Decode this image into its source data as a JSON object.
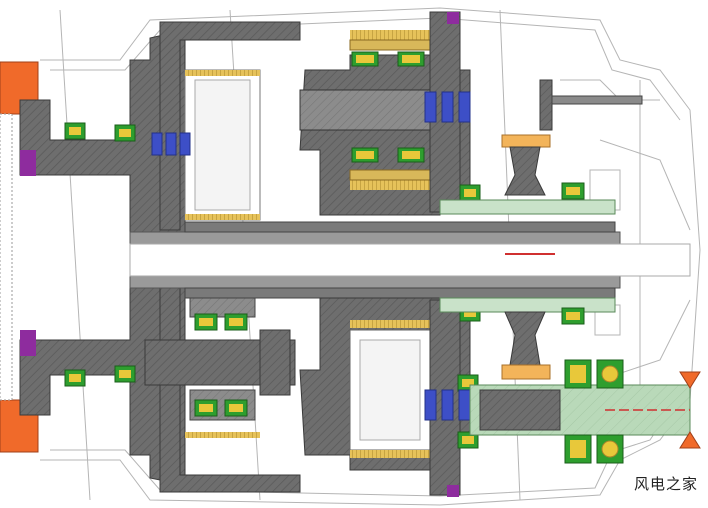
{
  "diagram": {
    "colors": {
      "background": "#ffffff",
      "housing_line": "#b0b0b0",
      "part_gray": "#6e6e6e",
      "part_gray_dark": "#4a4a4a",
      "part_gray_light": "#9a9a9a",
      "bearing_green": "#2e9e2e",
      "bearing_yellow": "#e8c83a",
      "pin_blue": "#3d4fc7",
      "flange_orange": "#f06a2a",
      "seal_purple": "#8e2c9e",
      "shaft_green": "#b9d9b9",
      "gear_orange": "#f3b45a",
      "red_mark": "#d03030",
      "teeth_yellow": "#e6c25a"
    }
  },
  "watermark": "风电之家"
}
